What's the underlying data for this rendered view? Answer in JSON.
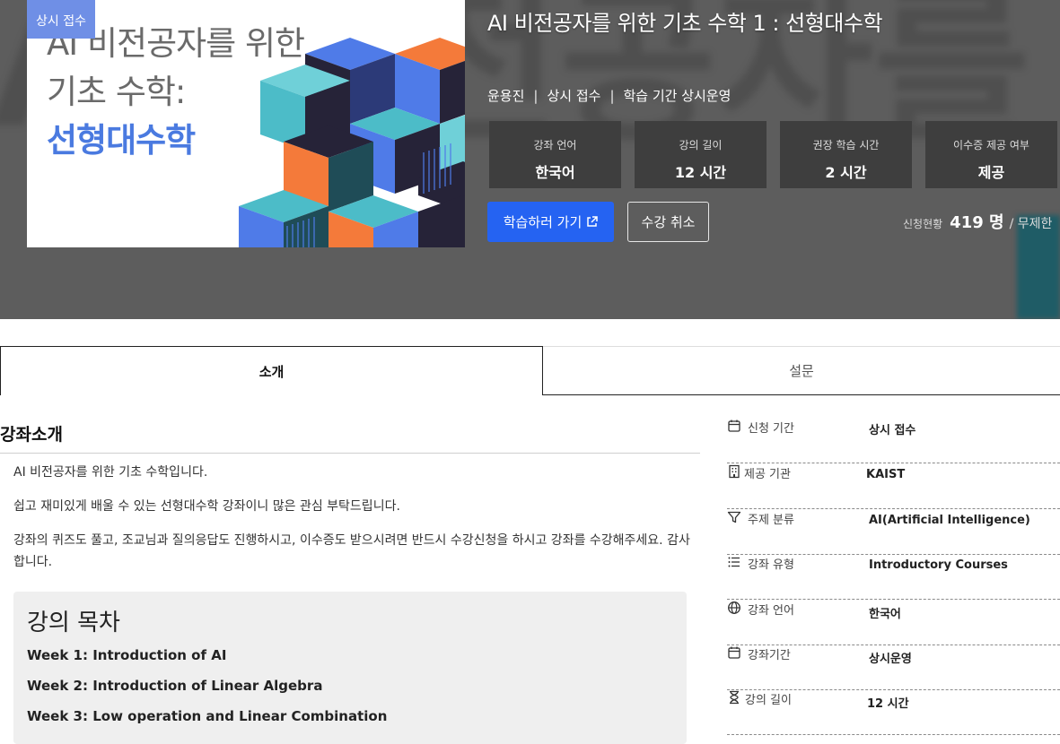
{
  "hero": {
    "bg_text": "AI 비전공자를 위한 기초 수학: 선형대수학",
    "thumbnail": {
      "badge": "상시 접수",
      "title_line1": "AI 비전공자를 위한",
      "title_line2": "기초 수학:",
      "title_line3": "선형대수학"
    },
    "title": "AI 비전공자를 위한 기초 수학 1 : 선형대수학",
    "meta": [
      "윤용진",
      "상시 접수",
      "학습 기간 상시운영"
    ],
    "info_boxes": [
      {
        "label": "강좌 언어",
        "value": "한국어"
      },
      {
        "label": "강의 길이",
        "value": "12 시간"
      },
      {
        "label": "권장 학습 시간",
        "value": "2 시간"
      },
      {
        "label": "이수증 제공 여부",
        "value": "제공"
      }
    ],
    "primary_button": "학습하러 가기",
    "secondary_button": "수강 취소",
    "enroll_label": "신청현황",
    "enroll_count": "419 명",
    "enroll_limit": "/ 무제한"
  },
  "tabs": [
    {
      "label": "소개",
      "active": true
    },
    {
      "label": "설문",
      "active": false
    }
  ],
  "intro": {
    "title": "강좌소개",
    "paragraphs": [
      "AI 비전공자를 위한 기초 수학입니다.",
      "쉽고 재미있게 배울 수 있는 선형대수학 강좌이니 많은 관심 부탁드립니다.",
      "강좌의 퀴즈도 풀고, 조교님과 질의응답도 진행하시고, 이수증도 받으시려면 반드시 수강신청을 하시고 강좌를 수강해주세요. 감사합니다."
    ]
  },
  "toc": {
    "title": "강의 목차",
    "items": [
      "Week 1: Introduction of AI",
      "Week 2: Introduction of Linear Algebra",
      "Week 3: Low operation and Linear Combination"
    ]
  },
  "sidebar": [
    {
      "icon": "calendar-icon",
      "label": "신청 기간",
      "value": "상시 접수"
    },
    {
      "icon": "building-icon",
      "label": "제공 기관",
      "value": "KAIST"
    },
    {
      "icon": "filter-icon",
      "label": "주제 분류",
      "value": "AI(Artificial Intelligence)"
    },
    {
      "icon": "list-icon",
      "label": "강좌 유형",
      "value": "Introductory Courses"
    },
    {
      "icon": "globe-icon",
      "label": "강좌 언어",
      "value": "한국어"
    },
    {
      "icon": "calendar-icon",
      "label": "강좌기간",
      "value": "상시운영"
    },
    {
      "icon": "hourglass-icon",
      "label": "강의 길이",
      "value": "12 시간"
    }
  ],
  "colors": {
    "primary": "#2563f2",
    "thumbnail_accent": "#4a7ae0",
    "cube_blue": "#4f7be8",
    "cube_orange": "#f47a3a",
    "cube_teal": "#4cbcc8",
    "cube_navy": "#262338"
  }
}
